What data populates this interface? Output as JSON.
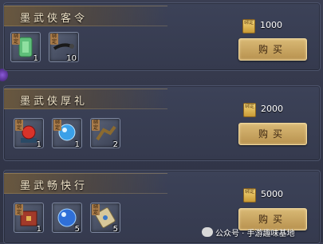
{
  "packs": [
    {
      "title": "墨武侠客令",
      "items": [
        {
          "icon": "jade-token-icon",
          "count": "1"
        },
        {
          "icon": "dark-flute-icon",
          "count": "10"
        }
      ],
      "price": "1000",
      "buy_label": "购买"
    },
    {
      "title": "墨武侠厚礼",
      "items": [
        {
          "icon": "red-orb-icon",
          "count": "1"
        },
        {
          "icon": "blue-crystal-icon",
          "count": "1"
        },
        {
          "icon": "bronze-figure-icon",
          "count": "2"
        }
      ],
      "price": "2000",
      "buy_label": "购买"
    },
    {
      "title": "墨武畅快行",
      "items": [
        {
          "icon": "treasure-chest-icon",
          "count": "1"
        },
        {
          "icon": "blue-pearl-icon",
          "count": "5"
        },
        {
          "icon": "scroll-icon",
          "count": "5"
        }
      ],
      "price": "5000",
      "buy_label": "购买"
    }
  ],
  "bind_tag": "绑定",
  "coin_tag": "绑定",
  "watermark": "公众号 · 手游趣味基地",
  "colors": {
    "gold_button": "#c9a45f",
    "panel": "#383d52"
  }
}
